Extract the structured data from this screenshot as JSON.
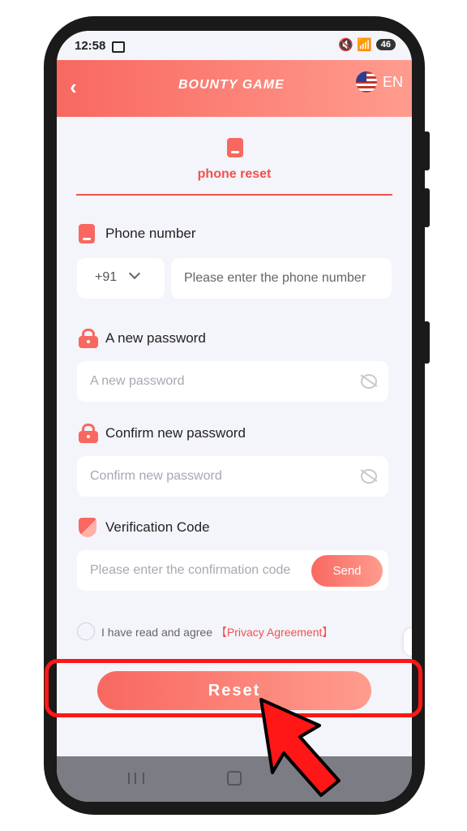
{
  "status_bar": {
    "time": "12:58",
    "signal_icons": "🔇 📶",
    "battery": "46"
  },
  "header": {
    "back_icon": "chevron-left-icon",
    "logo": "BOUNTY GAME",
    "language": "EN",
    "accent_gradient": [
      "#f86860",
      "#ff9c8e"
    ]
  },
  "tab": {
    "label": "phone reset"
  },
  "form": {
    "phone_label": "Phone number",
    "country_code": "+91",
    "phone_placeholder": "Please enter the phone number",
    "password_label": "A new password",
    "password_placeholder": "A new password",
    "confirm_label": "Confirm new password",
    "confirm_placeholder": "Confirm new password",
    "code_label": "Verification Code",
    "code_placeholder": "Please enter the confirmation code",
    "send_label": "Send"
  },
  "agreement": {
    "text": "I have read and agree",
    "link": "【Privacy Agreement】"
  },
  "reset_button": "Reset",
  "colors": {
    "accent": "#f1524a",
    "highlight": "#ff1616"
  }
}
